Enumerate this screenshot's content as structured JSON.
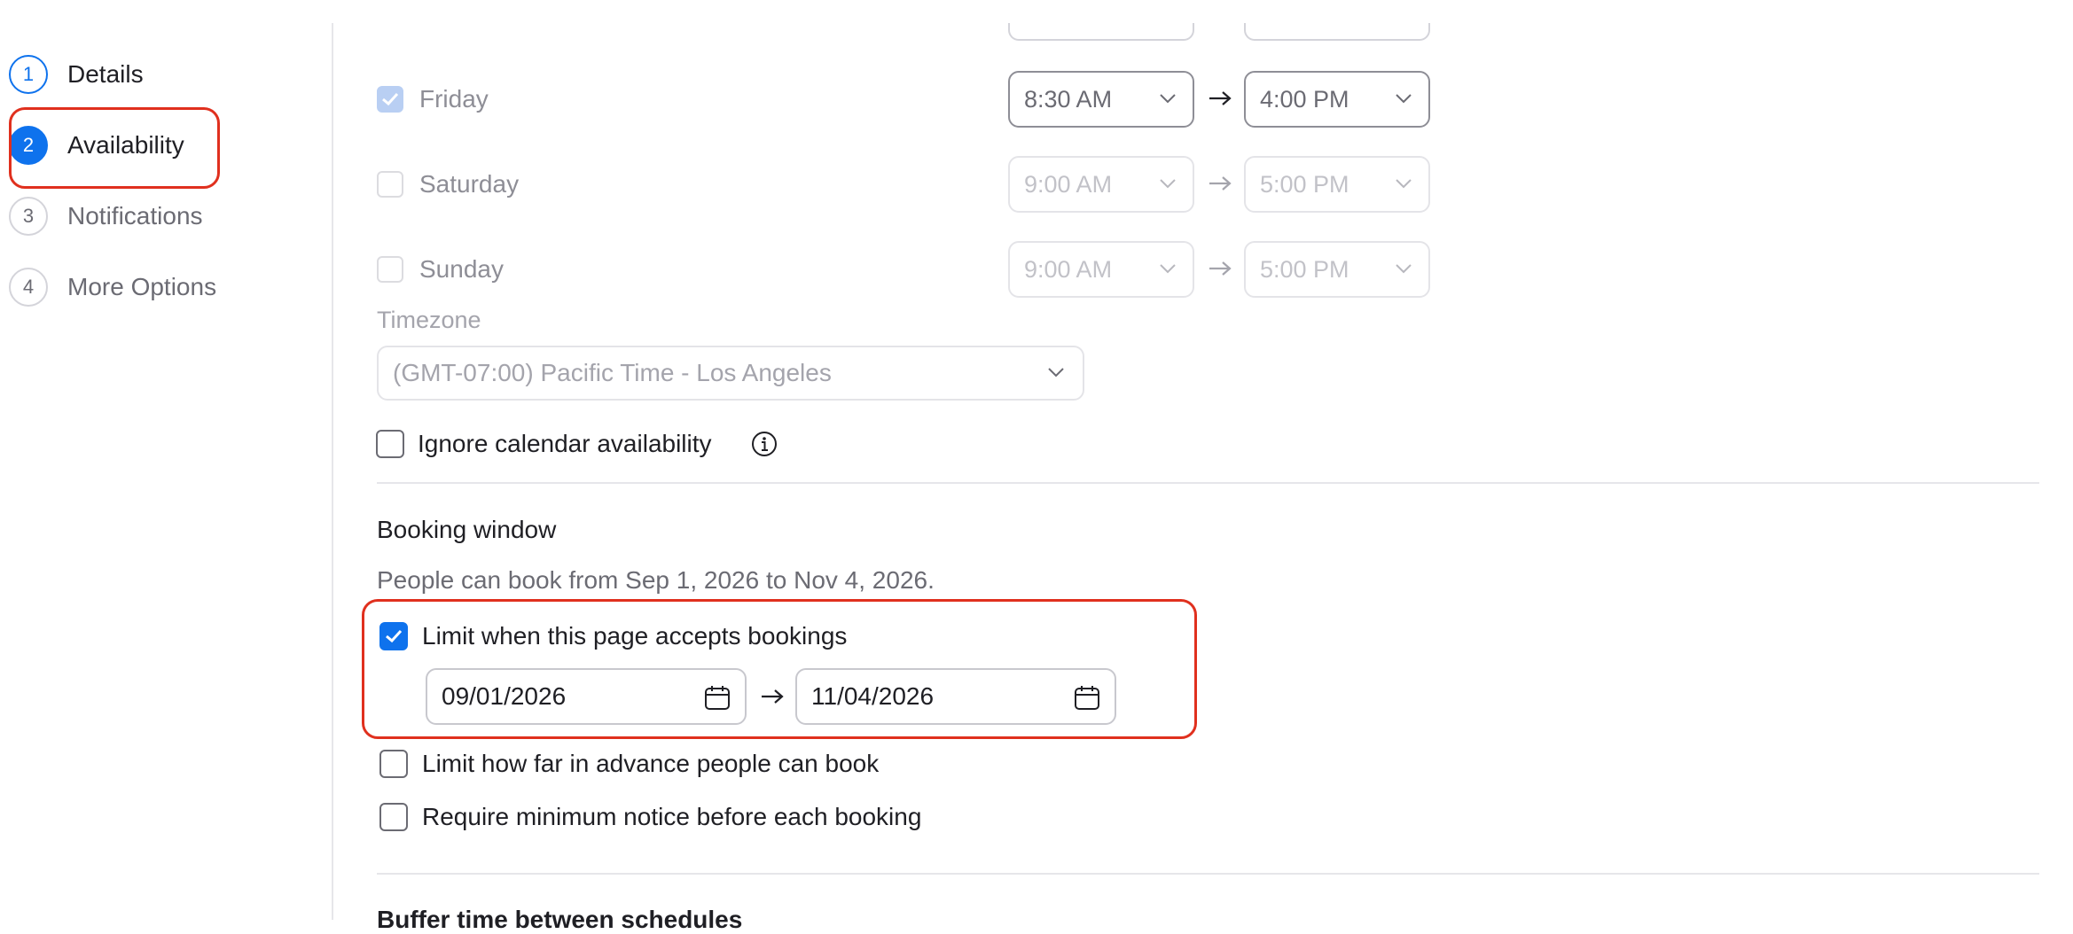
{
  "steps": [
    {
      "num": "1",
      "label": "Details"
    },
    {
      "num": "2",
      "label": "Availability"
    },
    {
      "num": "3",
      "label": "Notifications"
    },
    {
      "num": "4",
      "label": "More Options"
    }
  ],
  "days": [
    {
      "label": "Friday",
      "checked": true,
      "start": "8:30 AM",
      "end": "4:00 PM"
    },
    {
      "label": "Saturday",
      "checked": false,
      "start": "9:00 AM",
      "end": "5:00 PM"
    },
    {
      "label": "Sunday",
      "checked": false,
      "start": "9:00 AM",
      "end": "5:00 PM"
    }
  ],
  "timezone": {
    "label": "Timezone",
    "value": "(GMT-07:00) Pacific Time - Los Angeles"
  },
  "ignore_calendar": {
    "label": "Ignore calendar availability",
    "checked": false,
    "icon": "info-icon"
  },
  "booking_window": {
    "title": "Booking window",
    "description": "People can book from Sep 1, 2026 to Nov 4, 2026.",
    "limit_accepts": {
      "label": "Limit when this page accepts bookings",
      "checked": true
    },
    "start_date": "09/01/2026",
    "end_date": "11/04/2026",
    "limit_advance": {
      "label": "Limit how far in advance people can book",
      "checked": false
    },
    "min_notice": {
      "label": "Require minimum notice before each booking",
      "checked": false
    }
  },
  "next_section_title": "Buffer time between schedules",
  "colors": {
    "accent": "#0e72ed",
    "highlight": "#e0301e"
  }
}
